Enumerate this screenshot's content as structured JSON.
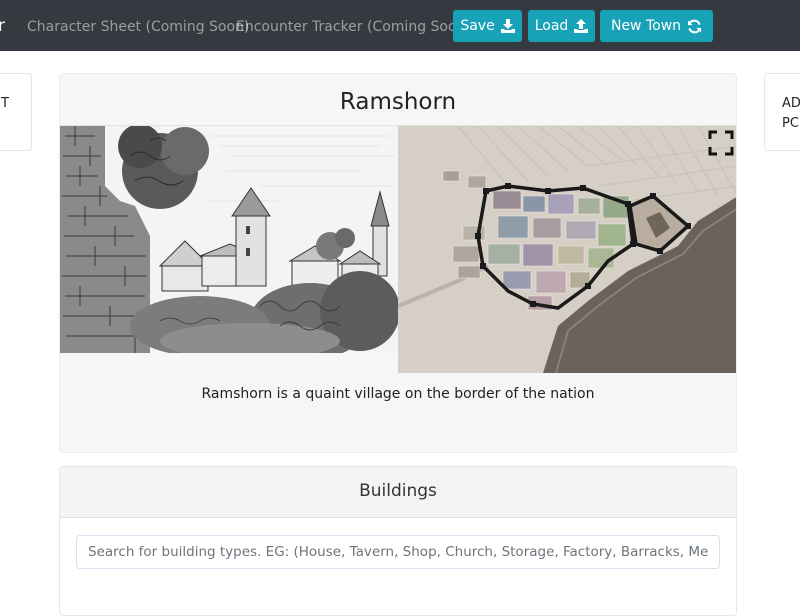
{
  "navbar": {
    "brand_tail": "r",
    "links": [
      "Character Sheet (Coming Soon)",
      "Encounter Tracker (Coming Soon)"
    ],
    "buttons": {
      "save": "Save",
      "load": "Load",
      "new_town": "New Town"
    },
    "icons": {
      "save": "download-icon",
      "load": "upload-icon",
      "new_town": "refresh-icon"
    },
    "accent_color": "#17a2b8"
  },
  "side_left": {
    "text": "T"
  },
  "side_right": {
    "line1": "AD",
    "line2": "PC"
  },
  "town": {
    "name": "Ramshorn",
    "description": "Ramshorn is a quaint village on the border of the nation",
    "images": [
      "sketch-illustration",
      "town-map"
    ],
    "fullscreen_icon": "fullscreen-icon"
  },
  "buildings": {
    "title": "Buildings",
    "search_placeholder": "Search for building types. EG: (House, Tavern, Shop, Church, Storage, Factory, Barracks, Medical, School"
  }
}
